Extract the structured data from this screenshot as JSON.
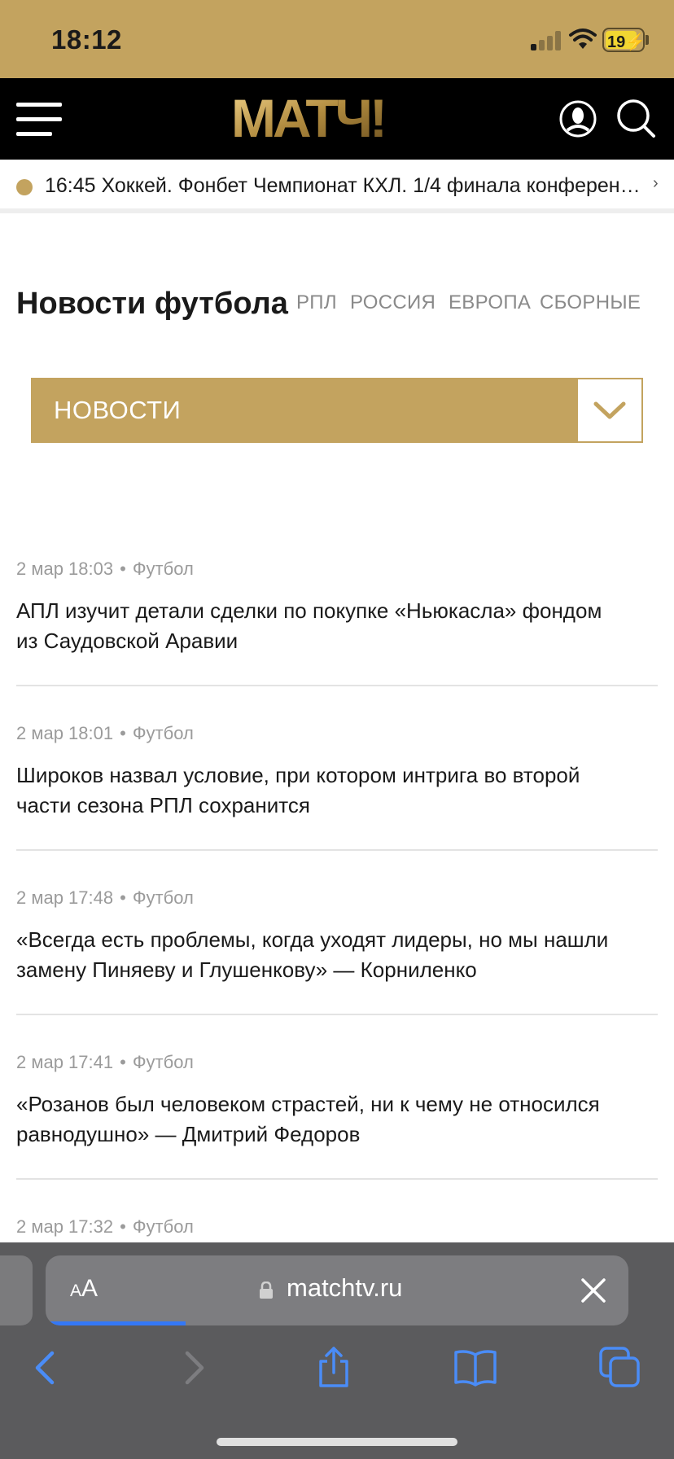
{
  "status_bar": {
    "time": "18:12",
    "battery": "19"
  },
  "header": {
    "logo_text": "МАТЧ!"
  },
  "ticker": {
    "text": "16:45 Хоккей. Фонбет Чемпионат КХЛ. 1/4 финала конференции"
  },
  "section": {
    "title": "Новости футбола",
    "subnav": [
      "РПЛ",
      "РОССИЯ",
      "ЕВРОПА",
      "СБОРНЫЕ"
    ]
  },
  "dropdown": {
    "selected": "НОВОСТИ"
  },
  "news": [
    {
      "date": "2 мар 18:03",
      "category": "Футбол",
      "title_line1": "АПЛ изучит детали сделки по покупке «Ньюкасла» фондом",
      "title_line2": "из Саудовской Аравии"
    },
    {
      "date": "2 мар 18:01",
      "category": "Футбол",
      "title_line1": "Широков назвал условие, при котором интрига во второй",
      "title_line2": "части сезона РПЛ сохранится"
    },
    {
      "date": "2 мар 17:48",
      "category": "Футбол",
      "title_line1": "«Всегда есть проблемы, когда уходят лидеры, но мы нашли",
      "title_line2": "замену Пиняеву и Глушенкову» — Корниленко"
    },
    {
      "date": "2 мар 17:41",
      "category": "Футбол",
      "title_line1": "«Розанов был человеком страстей, ни к чему не относился",
      "title_line2": "равнодушно» — Дмитрий Федоров"
    },
    {
      "date": "2 мар 17:32",
      "category": "Футбол",
      "title_line1": "",
      "title_line2": ""
    }
  ],
  "browser": {
    "aa_small": "A",
    "aa_large": "A",
    "url": "matchtv.ru",
    "load_progress": 0.24
  },
  "icons": {
    "menu": "hamburger-icon",
    "user": "user-icon",
    "search": "search-icon",
    "back": "chevron-left-icon",
    "forward": "chevron-right-icon",
    "share": "share-icon",
    "bookmarks": "book-icon",
    "tabs": "tabs-icon",
    "close": "close-icon",
    "lock": "lock-icon"
  },
  "colors": {
    "accent_gold": "#c3a35f",
    "header_bg": "#000000",
    "link_blue": "#3478f6"
  }
}
